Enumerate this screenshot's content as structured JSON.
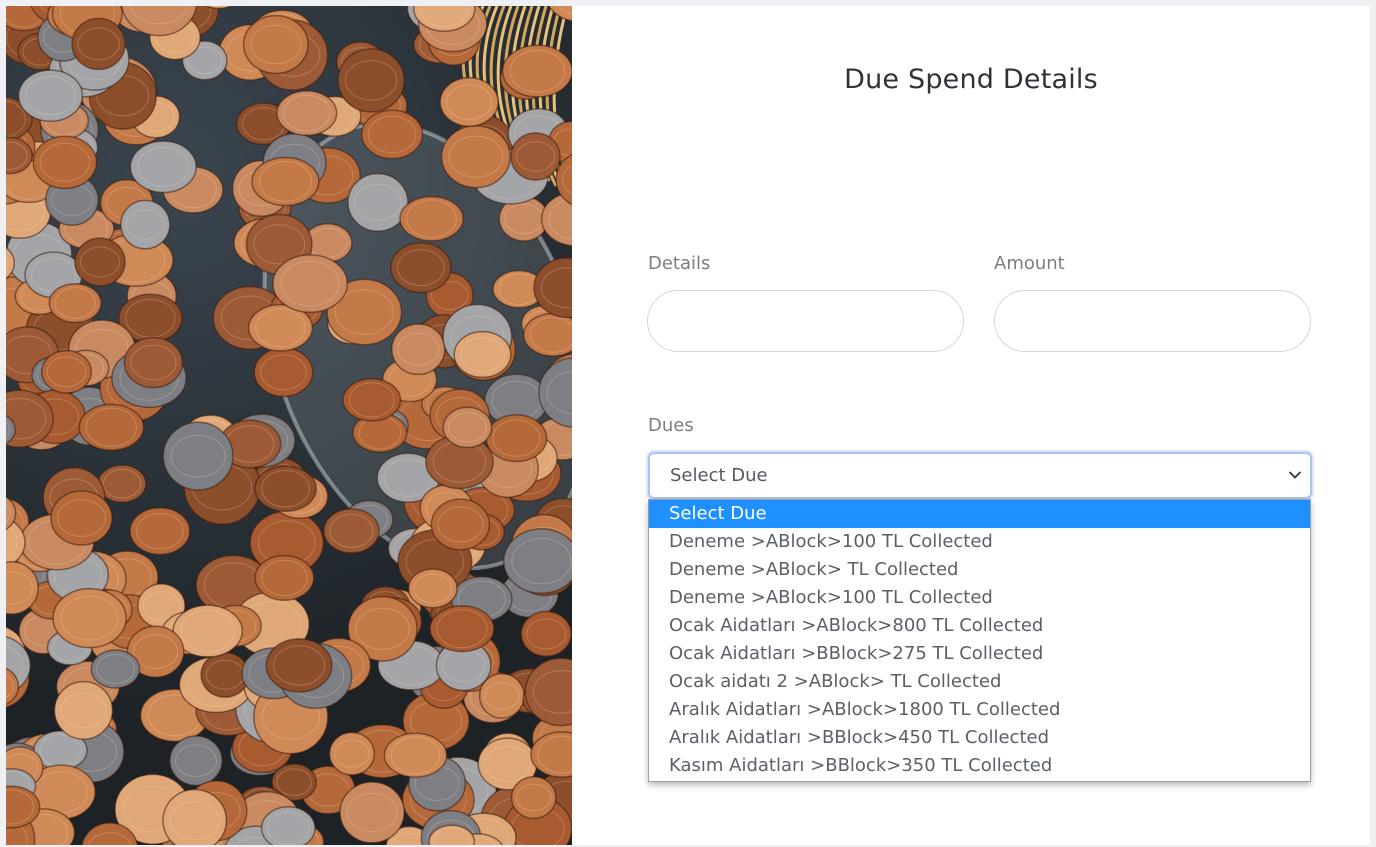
{
  "form": {
    "title": "Due Spend Details",
    "details_label": "Details",
    "details_value": "",
    "amount_label": "Amount",
    "amount_value": "",
    "dues_label": "Dues",
    "dues_selected": "Select Due",
    "dues_options": [
      "Select Due",
      "Deneme >ABlock>100 TL Collected",
      "Deneme >ABlock> TL Collected",
      "Deneme >ABlock>100 TL Collected",
      "Ocak Aidatları >ABlock>800 TL Collected",
      "Ocak Aidatları >BBlock>275 TL Collected",
      "Ocak aidatı 2 >ABlock> TL Collected",
      "Aralık Aidatları >ABlock>1800 TL Collected",
      "Aralık Aidatları >BBlock>450 TL Collected",
      "Kasım Aidatları >BBlock>350 TL Collected"
    ]
  },
  "photo": {
    "subject": "coins-spilling-from-glass-jar"
  },
  "colors": {
    "highlight": "#1e90ff",
    "focus": "#aac4ef",
    "copper": "#b06a3b"
  }
}
